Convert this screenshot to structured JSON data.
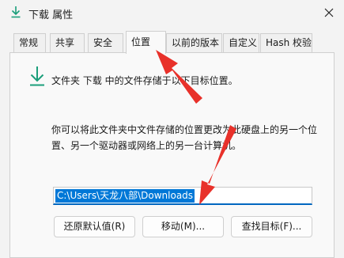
{
  "window": {
    "title": "下载 属性",
    "title_icon": "download-arrow-icon",
    "close_icon": "close-icon"
  },
  "tabs": [
    {
      "label": "常规",
      "active": false
    },
    {
      "label": "共享",
      "active": false
    },
    {
      "label": "安全",
      "active": false
    },
    {
      "label": "位置",
      "active": true
    },
    {
      "label": "以前的版本",
      "active": false
    },
    {
      "label": "自定义",
      "active": false
    },
    {
      "label": "Hash 校验",
      "active": false
    }
  ],
  "location": {
    "folder_icon": "download-arrow-icon",
    "info_line": "文件夹 下载 中的文件存储于以下目标位置。",
    "description": "你可以将此文件夹中文件存储的位置更改为此硬盘上的另一个位置、另一个驱动器或网络上的另一台计算机。",
    "path_value": "C:\\Users\\天龙八部\\Downloads"
  },
  "buttons": {
    "restore_default": "还原默认值(R)",
    "move": "移动(M)...",
    "find_target": "查找目标(F)..."
  },
  "colors": {
    "accent": "#0067c0",
    "selection": "#0078d7",
    "annotation_arrow": "#e8312a",
    "icon_green": "#1a9e7a"
  }
}
